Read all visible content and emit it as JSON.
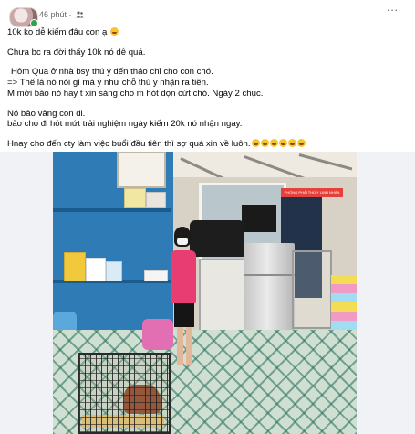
{
  "post": {
    "time": "46 phút",
    "dot": "·",
    "audience_icon": "friends-icon",
    "more_label": "···",
    "lines": [
      "10k ko dễ kiếm đâu con ạ",
      "Chưa bc ra đời thấy 10k nó dễ quá.",
      "Hôm Qua ở nhà bsy thú y đến tháo chỉ cho con chó.",
      "=> Thế là nó nói gì mà ý như chỗ thú y nhận ra tiền.",
      "M mới bảo nó hay t xin sáng cho m hót dọn cứt chó. Ngày 2 chục.",
      "Nó bảo vâng con đi.",
      "bảo cho đi hót mứt trải nghiệm ngày kiếm 20k nó nhận ngay.",
      "Hnay cho đến cty làm việc buổi đầu tiên thì sợ quá xin về luôn."
    ],
    "signboard_text": "PHÒNG PHẢI THÚ Y LINH NHÂN",
    "colors": {
      "accent_online": "#31a24c",
      "meta_gray": "#65676b",
      "text": "#050505",
      "emoji_yellow": "#f7c431"
    }
  }
}
